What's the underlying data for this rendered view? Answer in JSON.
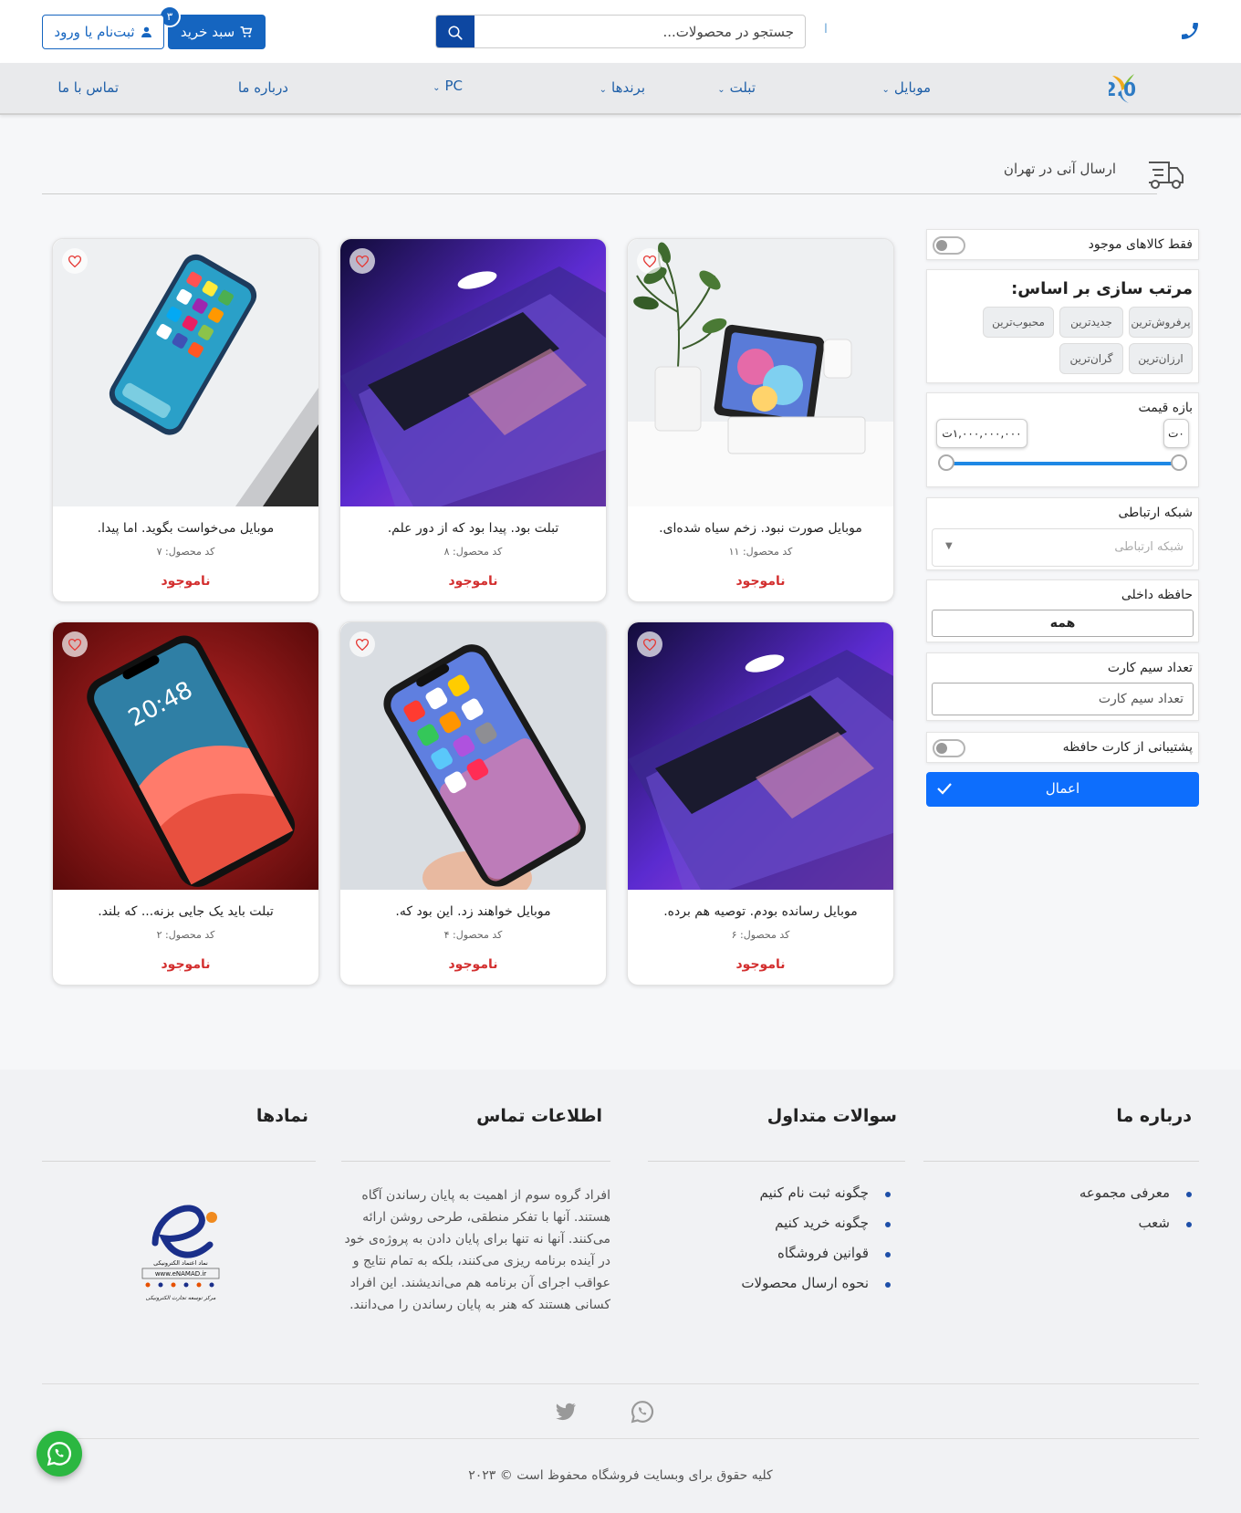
{
  "header": {
    "search_placeholder": "جستجو در محصولات...",
    "separator": "ا",
    "cart_label": "سبد خرید",
    "cart_count": "۳",
    "login_label": "ثبت‌نام یا ورود",
    "phone_icon": "phone-icon",
    "accent_color": "#1565c0"
  },
  "logo": {
    "text": "yii 2.0"
  },
  "nav": {
    "items": [
      {
        "label": "موبایل",
        "has_dropdown": true
      },
      {
        "label": "تبلت",
        "has_dropdown": true
      },
      {
        "label": "برندها",
        "has_dropdown": true
      },
      {
        "label": "PC",
        "has_dropdown": true
      },
      {
        "label": "درباره ما",
        "has_dropdown": false
      },
      {
        "label": "تماس با ما",
        "has_dropdown": false
      }
    ]
  },
  "banner": {
    "text": "ارسال آنی در تهران"
  },
  "filters": {
    "only_available_label": "فقط کالاهای موجود",
    "sort_title": "مرتب سازی بر اساس:",
    "sort_options": [
      "پرفروش‌ترین",
      "جدیدترین",
      "محبوب‌ترین",
      "ارزان‌ترین",
      "گران‌ترین"
    ],
    "price_title": "بازه قیمت",
    "price_min": "۰ت",
    "price_max": "۱,۰۰۰,۰۰۰,۰۰۰ت",
    "network_title": "شبکه ارتباطی",
    "network_placeholder": "شبکه ارتباطی",
    "memory_title": "حافظه داخلی",
    "memory_value": "همه",
    "sim_title": "تعداد سیم کارت",
    "sim_placeholder": "تعداد سیم کارت",
    "memcard_label": "پشتیبانی از کارت حافظه",
    "apply_label": "اعمال"
  },
  "products": [
    {
      "title": "موبایل صورت نبود. زخم سیاه شده‌ای.",
      "code": "کد محصول: ۱۱",
      "status": "ناموجود",
      "image": "tablet-on-desk"
    },
    {
      "title": "تبلت بود. پیدا بود که از دور علم.",
      "code": "کد محصول: ۸",
      "status": "ناموجود",
      "image": "laptop-purple"
    },
    {
      "title": "موبایل می‌خواست بگوید. اما پیدا.",
      "code": "کد محصول: ۷",
      "status": "ناموجود",
      "image": "iphone-on-laptop"
    },
    {
      "title": "موبایل رسانده بودم. توصیه هم برده.",
      "code": "کد محصول: ۶",
      "status": "ناموجود",
      "image": "laptop-purple"
    },
    {
      "title": "موبایل خواهند زد. این بود که.",
      "code": "کد محصول: ۴",
      "status": "ناموجود",
      "image": "iphone-in-hand"
    },
    {
      "title": "تبلت باید یک جایی بزنه... که بلند.",
      "code": "کد محصول: ۲",
      "status": "ناموجود",
      "image": "iphone-red"
    }
  ],
  "footer": {
    "about_title": "درباره ما",
    "about_links": [
      "معرفی مجموعه",
      "شعب"
    ],
    "faq_title": "سوالات متداول",
    "faq_links": [
      "چگونه ثبت نام کنیم",
      "چگونه خرید کنیم",
      "قوانین فروشگاه",
      "نحوه ارسال محصولات"
    ],
    "contact_title": "اطلاعات تماس",
    "contact_text": "افراد گروه سوم از اهمیت به پایان رساندن آگاه هستند. آنها با تفکر منطقی، طرحی روشن ارائه می‌کنند. آنها نه تنها برای پایان دادن به پروژه‌ی خود در آینده برنامه ریزی می‌کنند، بلکه به تمام نتایج و عواقب اجرای آن برنامه هم می‌اندیشند. این افراد کسانی هستند که هنر به پایان رساندن را می‌دانند.",
    "symbols_title": "نمادها",
    "enamad_line1": "نماد اعتماد الکترونیکی",
    "enamad_line2": "www.eNAMAD.ir",
    "enamad_line3": "مرکز توسعه تجارت الکترونیکی",
    "social_icons": [
      "whatsapp-icon",
      "twitter-icon"
    ],
    "copyright": "کلیه حقوق برای وبسایت فروشگاه محفوظ است © ۲۰۲۳"
  }
}
